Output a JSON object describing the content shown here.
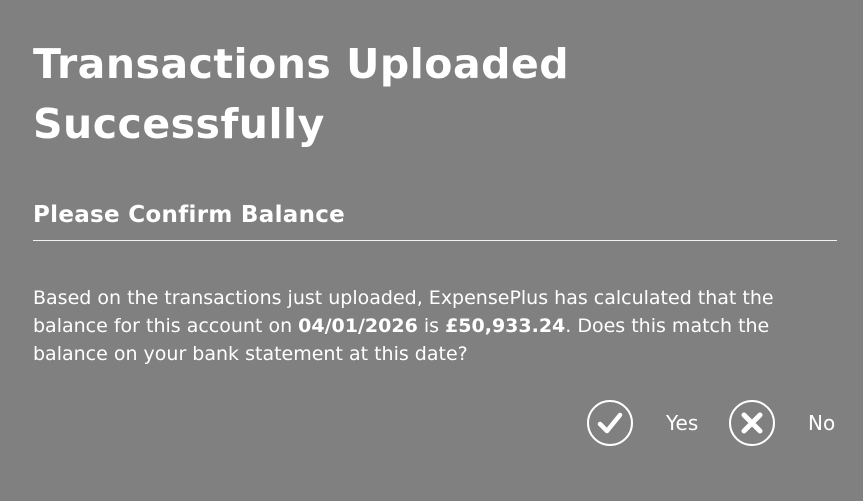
{
  "dialog": {
    "title": "Transactions Uploaded Successfully",
    "subtitle": "Please Confirm Balance",
    "message": {
      "part1": "Based on the transactions just uploaded, ExpensePlus has calculated that the balance for this account on ",
      "date": "04/01/2026",
      "part2": " is ",
      "amount": "£50,933.24",
      "part3": ". Does this match the balance on your bank statement at this date?"
    },
    "yes": {
      "label": "Yes",
      "icon": "check-circle-icon"
    },
    "no": {
      "label": "No",
      "icon": "x-circle-icon"
    }
  },
  "colors": {
    "background": "#808080",
    "foreground": "#ffffff"
  }
}
